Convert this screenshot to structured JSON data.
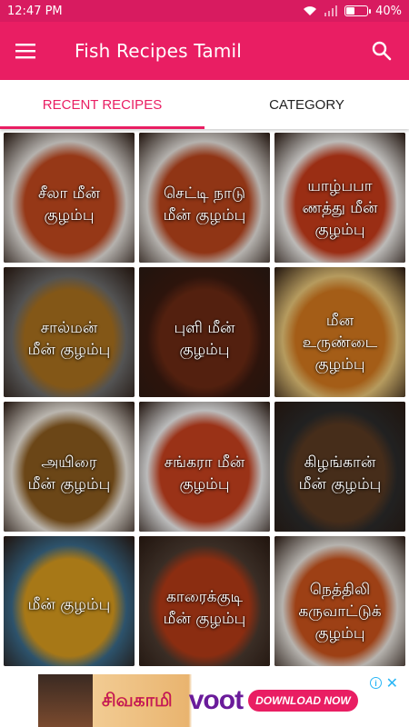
{
  "status_bar": {
    "time": "12:47 PM",
    "battery": "40%",
    "battery_level": 0.4,
    "color": "#d81b60"
  },
  "app_bar": {
    "title": "Fish Recipes Tamil",
    "menu_icon": "hamburger-menu-icon",
    "search_icon": "search-icon",
    "color": "#e91e63"
  },
  "tabs": [
    {
      "label": "RECENT RECIPES",
      "active": true
    },
    {
      "label": "CATEGORY",
      "active": false
    }
  ],
  "recipes": [
    {
      "title": "சீலா மீன்\nகுழம்பு",
      "plate": "#c0481e",
      "rim": "#e8e4df"
    },
    {
      "title": "செட்டி நாடு\nமீன் குழம்பு",
      "plate": "#b9441c",
      "rim": "#e8e4df"
    },
    {
      "title": "யாழ்பபா\nணத்து மீன்\nகுழம்பு",
      "plate": "#c63b1a",
      "rim": "#f1efec"
    },
    {
      "title": "சால்மன்\nமீன் குழம்பு",
      "plate": "#a8701e",
      "rim": "#6b6b6b"
    },
    {
      "title": "புளி மீன்\nகுழம்பு",
      "plate": "#6b2a14",
      "rim": "#3a1a10"
    },
    {
      "title": "மீன\nஉருண்டை\nகுழம்பு",
      "plate": "#d2781e",
      "rim": "#e9c77a"
    },
    {
      "title": "அயிரை\nமீன் குழம்பு",
      "plate": "#8a5a1e",
      "rim": "#efe9e0"
    },
    {
      "title": "சங்கரா மீன்\nகுழம்பு",
      "plate": "#c6401e",
      "rim": "#f0f0f0"
    },
    {
      "title": "கிழங்கான்\nமீன் குழம்பு",
      "plate": "#5a3a22",
      "rim": "#2b2b2b"
    },
    {
      "title": "மீன் குழம்பு",
      "plate": "#d79a1e",
      "rim": "#3a6a8a"
    },
    {
      "title": "காரைக்குடி\nமீன் குழம்பு",
      "plate": "#b33a16",
      "rim": "#4a3a30"
    },
    {
      "title": "நெத்திலி\nகருவாட்டுக்\nகுழம்பு",
      "plate": "#c9531c",
      "rim": "#eae6e0"
    }
  ],
  "ad": {
    "show_title": "சிவகாமி",
    "brand": "voot",
    "cta": "DOWNLOAD NOW",
    "info_label": "i",
    "close_label": "✕"
  }
}
